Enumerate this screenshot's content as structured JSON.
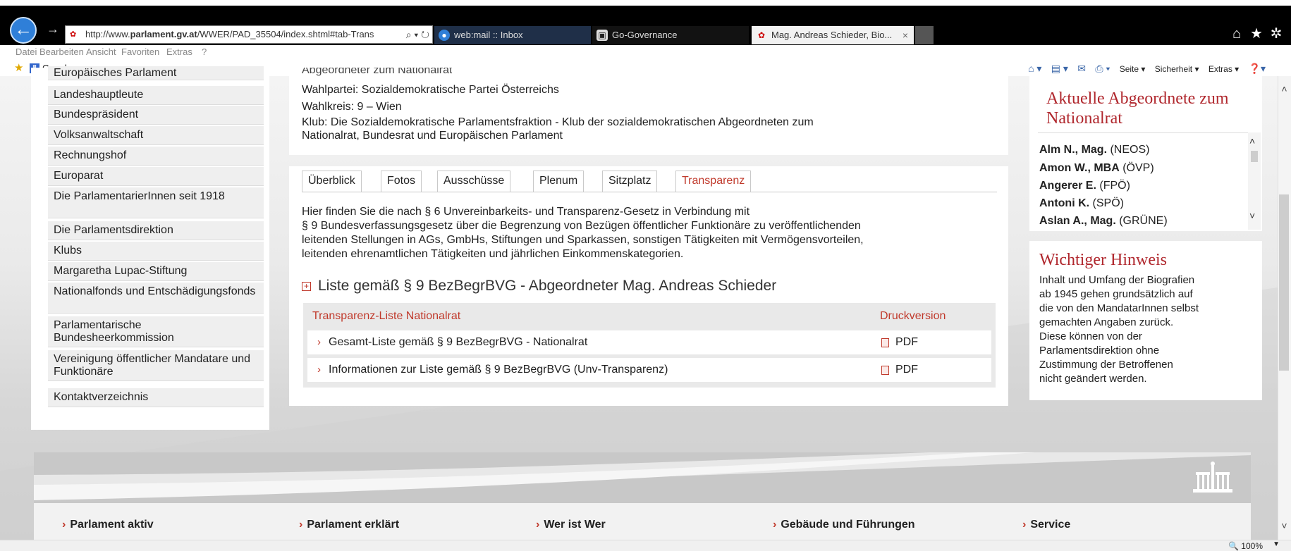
{
  "browser": {
    "url": "http://www.parlament.gv.at/WWER/PAD_35504/index.shtml#tab-Trans",
    "url_prefix": "http://www.",
    "url_host": "parlament.gv.at",
    "url_path": "/WWER/PAD_35504/index.shtml#tab-Trans",
    "tabs": [
      {
        "label": "web:mail :: Inbox"
      },
      {
        "label": "Go-Governance"
      },
      {
        "label": "Mag. Andreas Schieder, Bio...",
        "active": true
      }
    ],
    "close_tab": "×",
    "menu": [
      "Datei",
      "Bearbeiten",
      "Ansicht",
      "Favoriten",
      "Extras",
      "?"
    ],
    "favorites_bar": {
      "google_label": "Google"
    },
    "command_bar": {
      "seite": "Seite ▾",
      "sicherheit": "Sicherheit ▾",
      "extras": "Extras ▾"
    },
    "zoom": "100%"
  },
  "left_nav": {
    "items": [
      "Europäisches Parlament",
      "Landeshauptleute",
      "Bundespräsident",
      "Volksanwaltschaft",
      "Rechnungshof",
      "Europarat",
      "Die ParlamentarierInnen seit 1918",
      "Die Parlamentsdirektion",
      "Klubs",
      "Margaretha Lupac-Stiftung",
      "Nationalfonds und Entschädigungsfonds",
      "Parlamentarische Bundesheerkommission",
      "Vereinigung öffentlicher Mandatare und Funktionäre",
      "Kontaktverzeichnis"
    ]
  },
  "info": {
    "cut_line": "Abgeordneter zum Nationalrat",
    "wahlpartei": "Wahlpartei: Sozialdemokratische Partei Österreichs",
    "wahlkreis": "Wahlkreis: 9 – Wien",
    "klub_1": "Klub: Die Sozialdemokratische Parlamentsfraktion - Klub der sozialdemokratischen Abgeordneten zum",
    "klub_2": "Nationalrat, Bundesrat und Europäischen Parlament"
  },
  "tabs": [
    "Überblick",
    "Fotos",
    "Ausschüsse",
    "Plenum",
    "Sitzplatz",
    "Transparenz"
  ],
  "transparency": {
    "intro": [
      "Hier finden Sie die nach § 6 Unvereinbarkeits- und Transparenz-Gesetz in Verbindung mit",
      "§ 9 Bundesverfassungsgesetz über die Begrenzung von Bezügen öffentlicher Funktionäre zu veröffentlichenden",
      "leitenden Stellungen in AGs, GmbHs, Stiftungen und Sparkassen, sonstigen Tätigkeiten mit Vermögensvorteilen,",
      "leitenden ehrenamtlichen Tätigkeiten und jährlichen Einkommenskategorien."
    ],
    "list_heading": "Liste gemäß § 9 BezBegrBVG - Abgeordneter Mag. Andreas Schieder",
    "table_header_left": "Transparenz-Liste Nationalrat",
    "table_header_right": "Druckversion",
    "rows": [
      {
        "label": "Gesamt-Liste gemäß § 9 BezBegrBVG - Nationalrat",
        "format": "PDF"
      },
      {
        "label": "Informationen zur Liste gemäß § 9 BezBegrBVG (Unv-Transparenz)",
        "format": "PDF"
      }
    ]
  },
  "current_mps": {
    "title": "Aktuelle Abgeordnete zum Nationalrat",
    "items": [
      {
        "name": "Alm N., Mag.",
        "party": "(NEOS)"
      },
      {
        "name": "Amon W., MBA",
        "party": "(ÖVP)"
      },
      {
        "name": "Angerer E.",
        "party": "(FPÖ)"
      },
      {
        "name": "Antoni K.",
        "party": "(SPÖ)"
      },
      {
        "name": "Aslan A., Mag.",
        "party": "(GRÜNE)"
      }
    ]
  },
  "hint": {
    "title": "Wichtiger Hinweis",
    "lines": [
      "Inhalt und Umfang der Biografien",
      "ab 1945 gehen grundsätzlich auf",
      "die von den MandatarInnen selbst",
      "gemachten Angaben zurück.",
      "Diese können von der",
      "Parlamentsdirektion ohne",
      "Zustimmung der Betroffenen",
      "nicht geändert werden."
    ]
  },
  "footer": {
    "links": [
      "Parlament aktiv",
      "Parlament erklärt",
      "Wer ist Wer",
      "Gebäude und Führungen",
      "Service"
    ]
  },
  "colors": {
    "accent": "#c0392b",
    "title_red": "#b0272d",
    "browser_blue": "#2f7fd8"
  }
}
